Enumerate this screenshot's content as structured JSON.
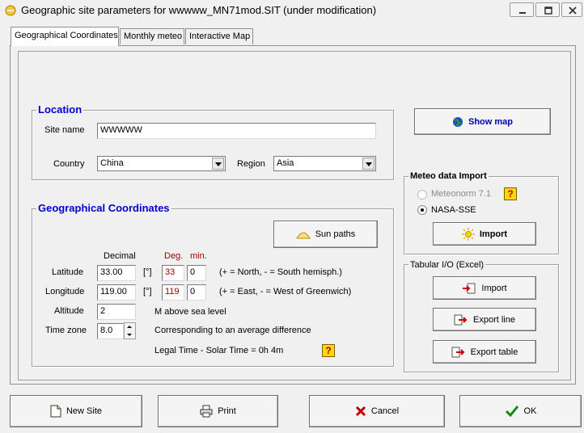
{
  "window": {
    "title": "Geographic site parameters for wwwww_MN71mod.SIT (under modification)"
  },
  "tabs": [
    {
      "label": "Geographical Coordinates",
      "active": true
    },
    {
      "label": "Monthly meteo",
      "active": false
    },
    {
      "label": "Interactive Map",
      "active": false
    }
  ],
  "location": {
    "title": "Location",
    "site_name_label": "Site name",
    "site_name_value": "WWWWW",
    "country_label": "Country",
    "country_value": "China",
    "region_label": "Region",
    "region_value": "Asia"
  },
  "show_map_label": "Show map",
  "geo": {
    "title": "Geographical Coordinates",
    "sun_paths_label": "Sun paths",
    "decimal_header": "Decimal",
    "deg_header": "Deg.",
    "min_header": "min.",
    "latitude_label": "Latitude",
    "latitude_decimal": "33.00",
    "latitude_unit": "[°]",
    "latitude_deg": "33",
    "latitude_min": "0",
    "latitude_hint": "(+ = North,  - = South hemisph.)",
    "longitude_label": "Longitude",
    "longitude_decimal": "119.00",
    "longitude_unit": "[°]",
    "longitude_deg": "119",
    "longitude_min": "0",
    "longitude_hint": "(+ = East, - = West of Greenwich)",
    "altitude_label": "Altitude",
    "altitude_value": "2",
    "altitude_hint": "M above sea level",
    "timezone_label": "Time zone",
    "timezone_value": "8.0",
    "timezone_hint": "Corresponding to an average difference",
    "legal_time_text": "Legal Time - Solar Time =   0h  4m"
  },
  "meteo_import": {
    "title": "Meteo data Import",
    "options": [
      {
        "label": "Meteonorm 7.1",
        "checked": false,
        "disabled": true
      },
      {
        "label": "NASA-SSE",
        "checked": true,
        "disabled": false
      }
    ],
    "import_label": "Import"
  },
  "tabular": {
    "title": "Tabular I/O (Excel)",
    "import_label": "Import",
    "export_line_label": "Export line",
    "export_table_label": "Export table"
  },
  "bottom": {
    "new_site_label": "New Site",
    "print_label": "Print",
    "cancel_label": "Cancel",
    "ok_label": "OK"
  }
}
